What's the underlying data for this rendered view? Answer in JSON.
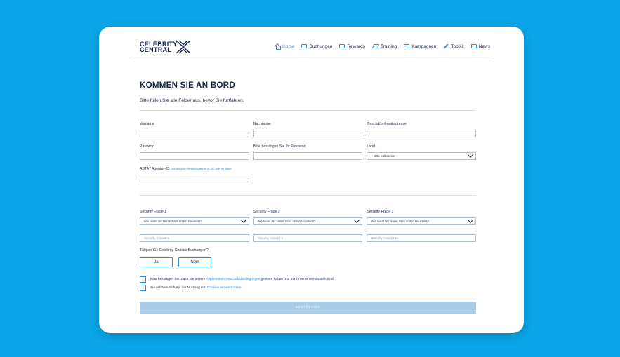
{
  "brand": {
    "line1": "CELEBRITY",
    "line2": "CENTRAL"
  },
  "nav": [
    {
      "label": "Home",
      "icon": "home-icon",
      "active": true
    },
    {
      "label": "Buchungen",
      "icon": "briefcase-icon"
    },
    {
      "label": "Rewards",
      "icon": "card-icon"
    },
    {
      "label": "Training",
      "icon": "graduation-icon"
    },
    {
      "label": "Kampagnen",
      "icon": "monitor-icon"
    },
    {
      "label": "Toolkit",
      "icon": "wrench-icon"
    },
    {
      "label": "News",
      "icon": "newspaper-icon"
    }
  ],
  "form": {
    "title": "KOMMEN SIE AN BORD",
    "subtitle": "Bitte füllen Sie alle Felder aus, bevor Sie fortfahren.",
    "firstname_label": "Vorname",
    "lastname_label": "Nachname",
    "email_label": "Geschäfts-Emailadresse",
    "password_label": "Passwort",
    "password_confirm_label": "Bitte bestätigen Sie Ihr Passwort",
    "country_label": "Land",
    "country_value": "-- Bitte wählen Sie --",
    "abta_label": "ABTA / Agentur-ID:",
    "abta_hint": "Ich bin kein Vertriebspartner in UK oder in Irland",
    "security": [
      {
        "label": "Security Frage 1",
        "question": "Wie lautet der Name Ihres ersten Haustiers?",
        "answer_placeholder": "Security Antwort 1"
      },
      {
        "label": "Security Frage 2",
        "question": "Wie lautet der Name Ihres ersten Haustiers?",
        "answer_placeholder": "Security Antwort 2"
      },
      {
        "label": "Security Frage 3",
        "question": "Wie lautet der Name Ihres ersten Haustiers?",
        "answer_placeholder": "Security Antwort 3"
      }
    ],
    "booking_question": "Tätigen Sie Celebrity Cruises Buchungen?",
    "yes_label": "Ja",
    "no_label": "Nein",
    "terms_pre": "Bitte bestätigen Sie, dass Sie unsere",
    "terms_link": "Allgemeinen Geschäftsbedingungen",
    "terms_post": "gelesen haben und mit ihnen einverstanden sind",
    "cookies_pre": "Sie erklären sich mit der Nutzung von",
    "cookies_link": "Cookies einverstanden",
    "submit_label": "BESTÄTIGEN"
  },
  "colors": {
    "background": "#0aa6e8",
    "accent": "#2d8fd5",
    "navy": "#16254a",
    "submit": "#a9cde6"
  }
}
